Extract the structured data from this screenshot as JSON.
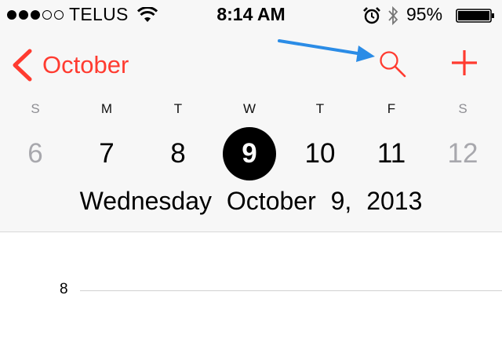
{
  "status_bar": {
    "carrier": "TELUS",
    "time": "8:14 AM",
    "battery_percent": "95%",
    "signal_bars_filled": 3,
    "signal_bars_total": 5
  },
  "nav": {
    "back_label": "October",
    "accent_color": "#ff3b30"
  },
  "week": {
    "days": [
      {
        "dow": "S",
        "num": "6",
        "weekend": true
      },
      {
        "dow": "M",
        "num": "7",
        "weekend": false
      },
      {
        "dow": "T",
        "num": "8",
        "weekend": false
      },
      {
        "dow": "W",
        "num": "9",
        "weekend": false,
        "selected": true
      },
      {
        "dow": "T",
        "num": "10",
        "weekend": false
      },
      {
        "dow": "F",
        "num": "11",
        "weekend": false
      },
      {
        "dow": "S",
        "num": "12",
        "weekend": true
      }
    ]
  },
  "selected_date": {
    "weekday": "Wednesday",
    "date": "October 9, 2013"
  },
  "timeline": {
    "hour_label": "8"
  },
  "icons": {
    "search": "search-icon",
    "add": "plus-icon",
    "back": "chevron-left-icon",
    "annotation": "arrow-annotation"
  }
}
